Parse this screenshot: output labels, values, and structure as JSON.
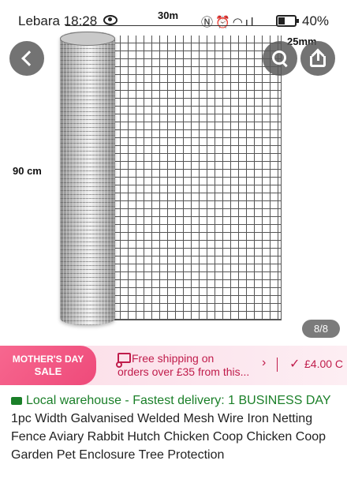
{
  "status_bar": {
    "carrier": "Lebara",
    "time": "18:28",
    "battery_percent": "40%",
    "icons": [
      "nfc-icon",
      "alarm-icon",
      "wifi-icon",
      "signal-icon"
    ]
  },
  "product_image": {
    "label_length": "30m",
    "label_height": "90 cm",
    "label_mesh": "25mm"
  },
  "image_nav": {
    "back_icon": "chevron-left-icon",
    "search_icon": "search-icon",
    "share_icon": "share-icon",
    "page_counter": "8/8"
  },
  "promo": {
    "badge_line1": "MOTHER'S DAY",
    "badge_line2": "SALE",
    "shipping_line1": "Free shipping on",
    "shipping_line2": "orders over £35 from this...",
    "chevron": "›",
    "check": "✓",
    "price": "£4.00 C"
  },
  "title": {
    "highlight": "Local warehouse - Fastest delivery: 1 BUSINESS DAY",
    "text": " 1pc Width Galvanised Welded Mesh Wire Iron Netting Fence Aviary Rabbit Hutch Chicken Coop Chicken Coop Garden Pet Enclosure Tree Protection"
  },
  "colors": {
    "promo_accent": "#c01c4b",
    "badge_pink": "#ee4a7a",
    "highlight_green": "#1a7f28"
  }
}
